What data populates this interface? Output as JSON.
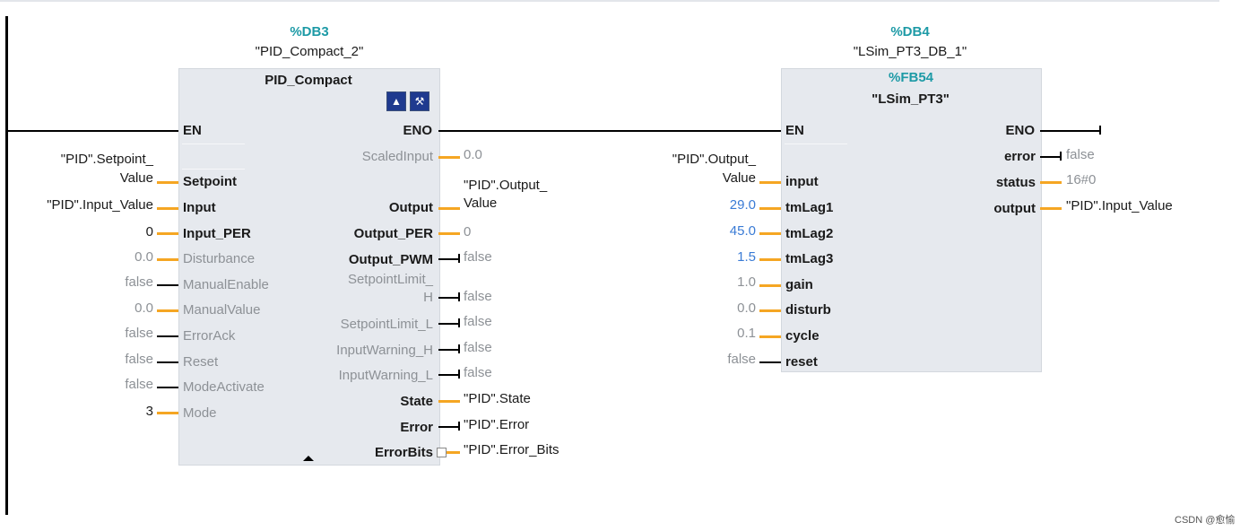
{
  "block1": {
    "db_addr": "%DB3",
    "db_name": "\"PID_Compact_2\"",
    "type_name": "PID_Compact",
    "icons": [
      "download-icon",
      "tools-icon"
    ],
    "en": "EN",
    "eno": "ENO",
    "inputs": [
      {
        "pin": "Setpoint",
        "arg1": "\"PID\".Setpoint_",
        "arg2": "Value"
      },
      {
        "pin": "Input",
        "arg": "\"PID\".Input_Value"
      },
      {
        "pin": "Input_PER",
        "arg": "0"
      },
      {
        "pin": "Disturbance",
        "arg": "0.0"
      },
      {
        "pin": "ManualEnable",
        "arg": "false"
      },
      {
        "pin": "ManualValue",
        "arg": "0.0"
      },
      {
        "pin": "ErrorAck",
        "arg": "false"
      },
      {
        "pin": "Reset",
        "arg": "false"
      },
      {
        "pin": "ModeActivate",
        "arg": "false"
      },
      {
        "pin": "Mode",
        "arg": "3"
      }
    ],
    "outputs": [
      {
        "pin": "ScaledInput",
        "arg": "0.0"
      },
      {
        "pin": "Output",
        "arg1": "\"PID\".Output_",
        "arg2": "Value"
      },
      {
        "pin": "Output_PER",
        "arg": "0"
      },
      {
        "pin": "Output_PWM",
        "arg": "false"
      },
      {
        "pin1": "SetpointLimit_",
        "pin2": "H",
        "arg": "false"
      },
      {
        "pin": "SetpointLimit_L",
        "arg": "false"
      },
      {
        "pin": "InputWarning_H",
        "arg": "false"
      },
      {
        "pin": "InputWarning_L",
        "arg": "false"
      },
      {
        "pin": "State",
        "arg": "\"PID\".State"
      },
      {
        "pin": "Error",
        "arg": "\"PID\".Error"
      },
      {
        "pin": "ErrorBits",
        "arg": "\"PID\".Error_Bits"
      }
    ]
  },
  "block2": {
    "db_addr": "%DB4",
    "db_name": "\"LSim_PT3_DB_1\"",
    "fb_addr": "%FB54",
    "fb_name": "\"LSim_PT3\"",
    "en": "EN",
    "eno": "ENO",
    "inputs": [
      {
        "pin": "input",
        "arg1": "\"PID\".Output_",
        "arg2": "Value"
      },
      {
        "pin": "tmLag1",
        "arg": "29.0"
      },
      {
        "pin": "tmLag2",
        "arg": "45.0"
      },
      {
        "pin": "tmLag3",
        "arg": "1.5"
      },
      {
        "pin": "gain",
        "arg": "1.0"
      },
      {
        "pin": "disturb",
        "arg": "0.0"
      },
      {
        "pin": "cycle",
        "arg": "0.1"
      },
      {
        "pin": "reset",
        "arg": "false"
      }
    ],
    "outputs": [
      {
        "pin": "error",
        "arg": "false"
      },
      {
        "pin": "status",
        "arg": "16#0"
      },
      {
        "pin": "output",
        "arg": "\"PID\".Input_Value"
      }
    ]
  },
  "colors": {
    "wire_real": "#f5a623",
    "wire_bool": "#000000",
    "db_address": "#1d9aa6",
    "constant_blue": "#3a7bd5",
    "inactive_text": "#8d9196",
    "block_fill": "#e6e9ee"
  },
  "watermark": "CSDN @愈愉"
}
